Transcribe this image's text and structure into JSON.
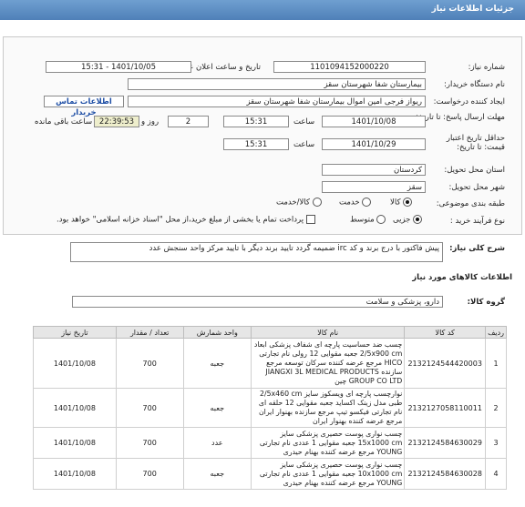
{
  "header": {
    "title": "جزئیات اطلاعات نیاز"
  },
  "fields": {
    "need_number_label": "شماره نیاز:",
    "need_number": "1101094152000220",
    "announce_label": "تاریخ و ساعت اعلان عمومی:",
    "announce_value": "1401/10/05 - 15:31",
    "buyer_org_label": "نام دستگاه خریدار:",
    "buyer_org": "بیمارستان شفا شهرستان سقز",
    "requester_label": "ایجاد کننده درخواست:",
    "requester": "ریواز فرجی امین اموال بیمارستان شفا شهرستان سقز",
    "contact_link": "اطلاعات تماس خریدار",
    "deadline_label": "مهلت ارسال پاسخ: تا تاریخ:",
    "deadline_date": "1401/10/08",
    "time_label": "ساعت",
    "deadline_time": "15:31",
    "days": "2",
    "days_label": "روز و",
    "remaining": "22:39:53",
    "remaining_label": "ساعت باقی مانده",
    "min_price_label": "حداقل تاریخ اعتبار قیمت: تا تاریخ:",
    "min_price_date": "1401/10/29",
    "min_price_time_label": "ساعت",
    "min_price_time": "15:31",
    "province_label": "استان محل تحویل:",
    "province": "کردستان",
    "city_label": "شهر محل تحویل:",
    "city": "سقز",
    "category_label": "طبقه بندی موضوعی:",
    "category_options": [
      "کالا",
      "خدمت",
      "کالا/خدمت"
    ],
    "process_label": "نوع فرآیند خرید :",
    "process_options": [
      "جزیی",
      "متوسط"
    ],
    "payment_note": "پرداخت تمام یا بخشی از مبلغ خرید،از محل \"اسناد خزانه اسلامی\" خواهد بود."
  },
  "description": {
    "label": "شرح کلی نیاز:",
    "text": "پیش فاکتور با درج برند و کد irc ضمیمه گردد تایید برند دیگر با تایید مرکز واحد سنجش عدد"
  },
  "goods": {
    "section_title": "اطلاعات کالاهای مورد نیاز",
    "group_label": "گروه کالا:",
    "group_value": "دارو، پزشکی و سلامت",
    "columns": [
      "ردیف",
      "کد کالا",
      "نام کالا",
      "واحد شمارش",
      "تعداد / مقدار",
      "تاریخ نیاز"
    ],
    "rows": [
      {
        "idx": "1",
        "code": "2132124544420003",
        "name": "چسب ضد حساسیت پارچه ای شفاف پزشکی ابعاد 2/5x900 cm جعبه مقوایی 12 رولی نام تجارتی HICO مرجع عرضه کننده سرکان توسعه مرجع سازنده JIANGXI 3L MEDICAL PRODUCTS GROUP CO LTD چین",
        "unit": "جعبه",
        "qty": "700",
        "date": "1401/10/08"
      },
      {
        "idx": "2",
        "code": "2132127058110011",
        "name": "نوارچسب پارچه ای ویسکوز سایز 2/5x460 cm طبی مدل زینک اکساید جعبه مقوایی 12 حلقه ای نام تجارتی فیکسو تیپ مرجع سازنده بهنوار ایران مرجع عرضه کننده بهنوار ایران",
        "unit": "جعبه",
        "qty": "700",
        "date": "1401/10/08"
      },
      {
        "idx": "3",
        "code": "2132124584630029",
        "name": "چسب نواری پوست حصیری پزشکی سایز 15x1000 cm جعبه مقوایی 1 عددی نام تجارتی YOUNG مرجع عرضه کننده بهنام حیدری",
        "unit": "عدد",
        "qty": "700",
        "date": "1401/10/08"
      },
      {
        "idx": "4",
        "code": "2132124584630028",
        "name": "چسب نواری پوست حصیری پزشکی سایز 10x1000 cm جعبه مقوایی 1 عددی نام تجارتی YOUNG مرجع عرضه کننده بهنام حیدری",
        "unit": "جعبه",
        "qty": "700",
        "date": "1401/10/08"
      }
    ]
  }
}
